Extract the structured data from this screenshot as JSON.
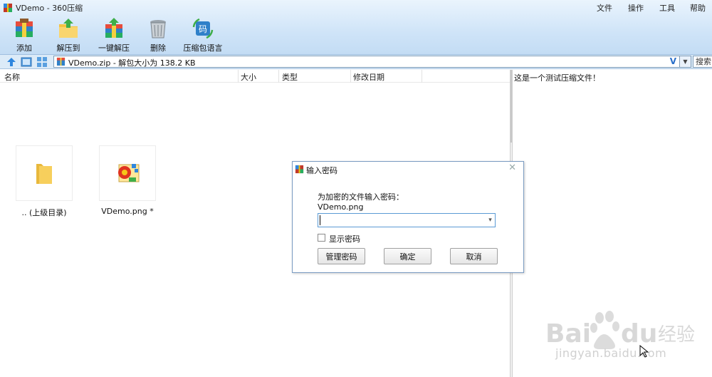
{
  "app": {
    "title": "VDemo - 360压缩"
  },
  "menu": [
    "文件",
    "操作",
    "工具",
    "帮助"
  ],
  "toolbar": [
    {
      "label": "添加",
      "icon": "add-archive-icon"
    },
    {
      "label": "解压到",
      "icon": "extract-to-icon"
    },
    {
      "label": "一键解压",
      "icon": "quick-extract-icon"
    },
    {
      "label": "删除",
      "icon": "delete-trash-icon"
    },
    {
      "label": "压缩包语言",
      "icon": "archive-language-icon"
    }
  ],
  "address": {
    "path": "VDemo.zip - 解包大小为 138.2 KB",
    "v_badge": "V",
    "search_placeholder": "搜索"
  },
  "columns": [
    "名称",
    "大小",
    "类型",
    "修改日期"
  ],
  "files": [
    {
      "name": ".. (上级目录)",
      "icon": "folder-icon"
    },
    {
      "name": "VDemo.png *",
      "icon": "png-image-icon"
    }
  ],
  "comment": "这是一个测试压缩文件！",
  "dialog": {
    "title": "输入密码",
    "prompt": "为加密的文件输入密码：",
    "filename": "VDemo.png",
    "password_value": "",
    "show_password_label": "显示密码",
    "show_password_checked": false,
    "buttons": {
      "manage": "管理密码",
      "ok": "确定",
      "cancel": "取消"
    }
  },
  "watermark": {
    "url": "jingyan.baidu.com"
  },
  "colors": {
    "accent": "#5b9bd5",
    "toolbar_bg": "#cfe4f8"
  }
}
